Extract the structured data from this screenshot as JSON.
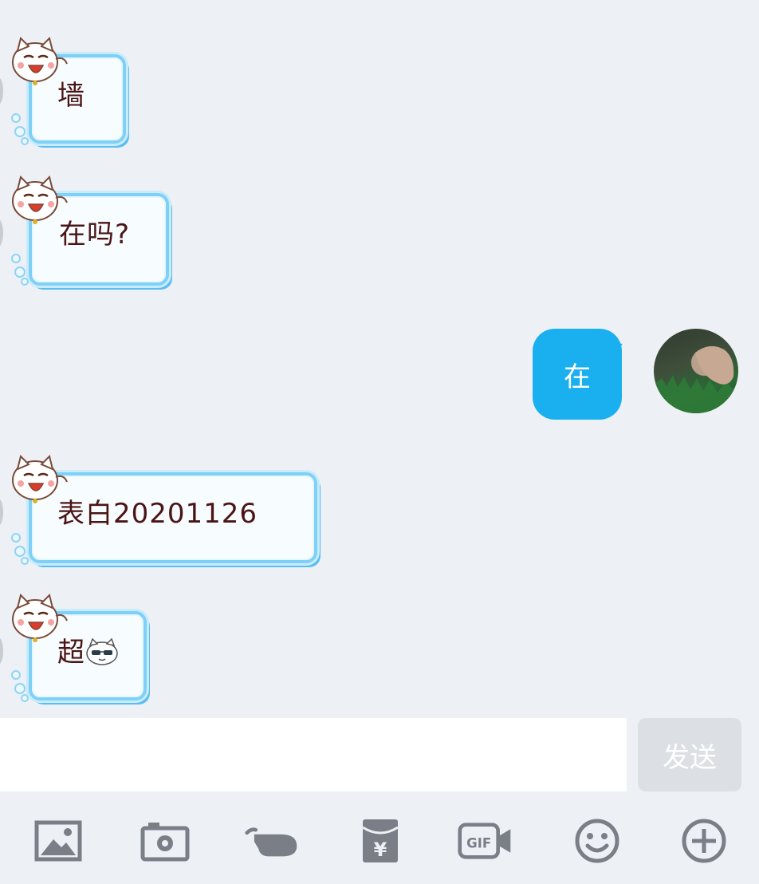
{
  "messages": [
    {
      "side": "in",
      "text": "墙"
    },
    {
      "side": "in",
      "text": "在吗?"
    },
    {
      "side": "out",
      "text": "在"
    },
    {
      "side": "in",
      "text": "表白20201126"
    },
    {
      "side": "in",
      "text": "超"
    }
  ],
  "input": {
    "value": "",
    "placeholder": ""
  },
  "send_label": "发送",
  "toolbar": {
    "icons": [
      "image-icon",
      "camera-icon",
      "poke-hand-icon",
      "red-packet-icon",
      "gif-icon",
      "emoji-icon",
      "plus-icon"
    ],
    "red_packet_symbol": "¥",
    "gif_label": "GIF"
  },
  "colors": {
    "background": "#edf0f5",
    "outgoing_bubble": "#1ab0f0",
    "incoming_border": "#7fd0f6",
    "incoming_text": "#4a1414",
    "toolbar_icon": "#7a7e86",
    "send_button": "#dcdfe4"
  }
}
